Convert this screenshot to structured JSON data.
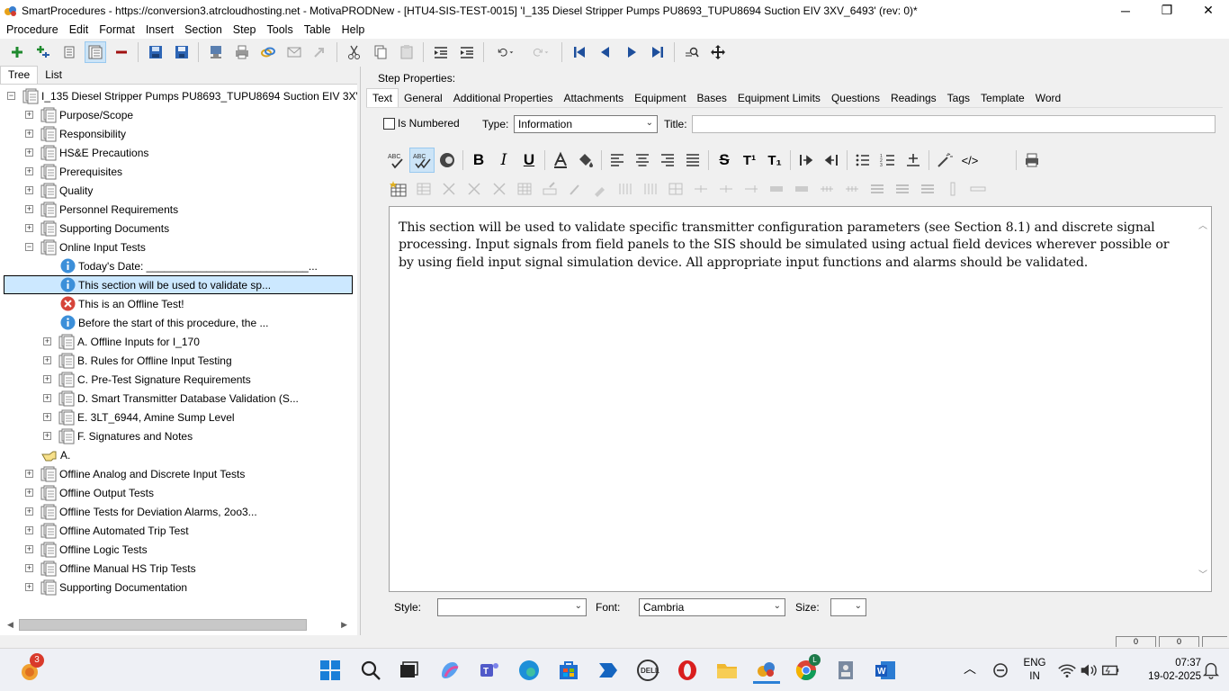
{
  "window": {
    "title": "SmartProcedures - https://conversion3.atrcloudhosting.net - MotivaPRODNew - [HTU4-SIS-TEST-0015] 'I_135 Diesel Stripper Pumps PU8693_TUPU8694 Suction EIV 3XV_6493' (rev: 0)*",
    "minimize_glyph": "─",
    "restore_glyph": "❐",
    "close_glyph": "✕"
  },
  "menu": [
    "Procedure",
    "Edit",
    "Format",
    "Insert",
    "Section",
    "Step",
    "Tools",
    "Table",
    "Help"
  ],
  "left_tabs": {
    "tree": "Tree",
    "list": "List"
  },
  "tree": {
    "root": "I_135  Diesel  Stripper  Pumps  PU8693_TUPU8694  Suction  EIV  3XV...",
    "items": [
      {
        "label": "Purpose/Scope",
        "expander": "+"
      },
      {
        "label": "Responsibility",
        "expander": "+"
      },
      {
        "label": "HS&E Precautions",
        "expander": "+"
      },
      {
        "label": "Prerequisites",
        "expander": "+"
      },
      {
        "label": "Quality",
        "expander": "+"
      },
      {
        "label": "Personnel Requirements",
        "expander": "+"
      },
      {
        "label": "Supporting Documents",
        "expander": "+"
      },
      {
        "label": "Online Input Tests",
        "expander": "−"
      },
      {
        "label": "Today's Date: ___________________________...",
        "icon": "info"
      },
      {
        "label": "This section will be used to validate sp...",
        "icon": "info"
      },
      {
        "label": "This is an Offline Test!",
        "icon": "error"
      },
      {
        "label": "Before the start of this procedure, the ...",
        "icon": "info"
      },
      {
        "label": "A. Offline Inputs for I_170",
        "expander": "+"
      },
      {
        "label": "B. Rules for Offline Input Testing",
        "expander": "+"
      },
      {
        "label": "C. Pre-Test Signature Requirements",
        "expander": "+"
      },
      {
        "label": "D. Smart Transmitter Database Validation (S...",
        "expander": "+"
      },
      {
        "label": "E. 3LT_6944, Amine Sump Level",
        "expander": "+"
      },
      {
        "label": "F. Signatures and Notes",
        "expander": "+"
      },
      {
        "label": "A.",
        "icon": "hand"
      },
      {
        "label": "Offline Analog and Discrete Input Tests",
        "expander": "+"
      },
      {
        "label": "Offline Output Tests",
        "expander": "+"
      },
      {
        "label": "Offline Tests for Deviation Alarms, 2oo3...",
        "expander": "+"
      },
      {
        "label": "Offline Automated Trip Test",
        "expander": "+"
      },
      {
        "label": "Offline Logic Tests",
        "expander": "+"
      },
      {
        "label": "Offline Manual HS Trip Tests",
        "expander": "+"
      },
      {
        "label": "Supporting Documentation",
        "expander": "+"
      }
    ]
  },
  "step_properties": {
    "header": "Step Properties:",
    "tabs": [
      "Text",
      "General",
      "Additional Properties",
      "Attachments",
      "Equipment",
      "Bases",
      "Equipment Limits",
      "Questions",
      "Readings",
      "Tags",
      "Template",
      "Word"
    ],
    "is_numbered_label": "Is Numbered",
    "type_label": "Type:",
    "type_value": "Information",
    "title_label": "Title:",
    "title_value": "",
    "text": "This section will be used to validate specific transmitter configuration parameters (see Section 8.1) and discrete signal processing. Input signals from field panels to the SIS should be simulated using actual field devices wherever possible or by using field input signal simulation device. All appropriate input functions and alarms should be validated.",
    "style_label": "Style:",
    "style_value": "",
    "font_label": "Font:",
    "font_value": "Cambria",
    "size_label": "Size:",
    "size_value": ""
  },
  "format_toolbar": {
    "bold": "B",
    "italic": "I",
    "underline": "U",
    "strike": "S",
    "superscript": "T¹",
    "subscript": "T₁",
    "html": "</>"
  },
  "status": {
    "box1": "0",
    "box2": "0"
  },
  "taskbar": {
    "badge": "3",
    "chrome_badge": "L",
    "lang_line1": "ENG",
    "lang_line2": "IN",
    "time": "07:37",
    "date": "19-02-2025"
  },
  "colors": {
    "selection": "#cce8ff",
    "info_icon": "#3c8fd9",
    "error_icon": "#d6453a",
    "accent_blue": "#1e63b7"
  }
}
